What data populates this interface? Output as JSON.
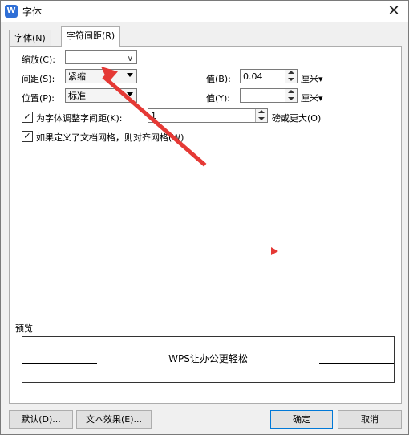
{
  "window": {
    "title": "字体",
    "app_icon_letter": "W",
    "close_glyph": "✕"
  },
  "tabs": [
    {
      "label": "字体(N)"
    },
    {
      "label": "字符间距(R)"
    }
  ],
  "scale": {
    "label": "缩放(C):",
    "value": ""
  },
  "spacing": {
    "label": "间距(S):",
    "value": "紧缩",
    "amount_label": "值(B):",
    "amount_value": "0.04",
    "unit": "厘米▾"
  },
  "position": {
    "label": "位置(P):",
    "value": "标准",
    "amount_label": "值(Y):",
    "amount_value": "",
    "unit": "厘米▾"
  },
  "kerning": {
    "checked": true,
    "check_glyph": "✓",
    "label": "为字体调整字间距(K):",
    "value": "1",
    "suffix": "磅或更大(O)"
  },
  "snap_grid": {
    "checked": true,
    "check_glyph": "✓",
    "label": "如果定义了文档网格，则对齐网格(W)"
  },
  "preview": {
    "label": "预览",
    "text": "WPS让办公更轻松"
  },
  "buttons": {
    "default": "默认(D)...",
    "text_effects": "文本效果(E)...",
    "ok": "确定",
    "cancel": "取消"
  },
  "colors": {
    "annotation_red": "#e53935",
    "focus_blue": "#0078d7"
  }
}
